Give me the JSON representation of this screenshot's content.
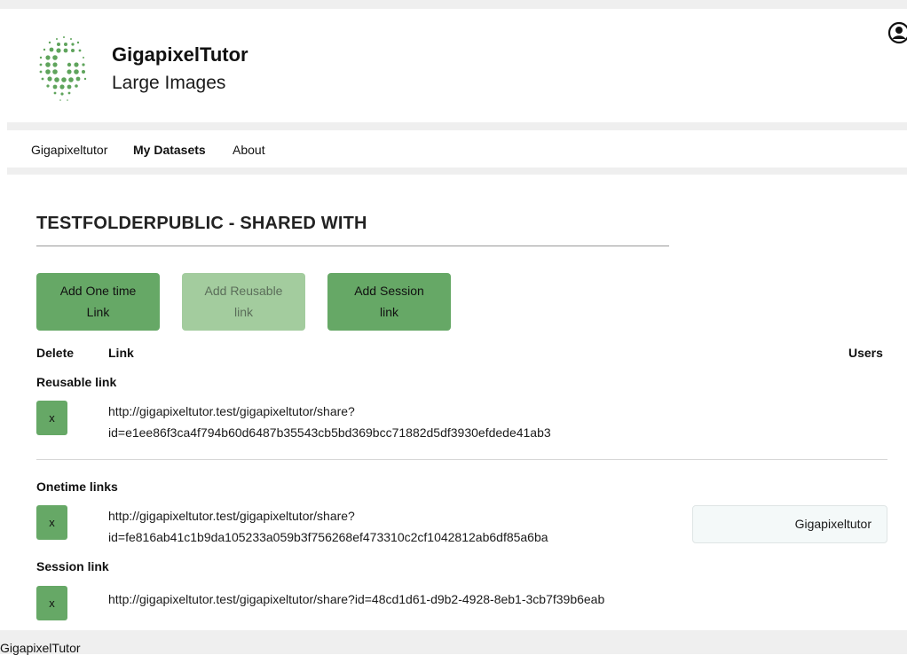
{
  "brand": {
    "title": "GigapixelTutor",
    "subtitle": "Large Images"
  },
  "nav": {
    "items": [
      "Gigapixeltutor",
      "My Datasets",
      "About"
    ],
    "active": "My Datasets"
  },
  "page": {
    "title": "TESTFOLDERPUBLIC - SHARED WITH"
  },
  "buttons": {
    "one_time": {
      "line1": "Add One time",
      "line2": "Link"
    },
    "reusable": {
      "line1": "Add Reusable",
      "line2": "link",
      "disabled": true
    },
    "session": {
      "line1": "Add Session",
      "line2": "link"
    }
  },
  "columns": {
    "delete": "Delete",
    "link": "Link",
    "users": "Users"
  },
  "sections": {
    "reusable": {
      "heading": "Reusable link",
      "delete_label": "x",
      "url_line1": "http://gigapixeltutor.test/gigapixeltutor/share?",
      "url_line2": "id=e1ee86f3ca4f794b60d6487b35543cb5bd369bcc71882d5df3930efdede41ab3"
    },
    "onetime": {
      "heading": "Onetime links",
      "delete_label": "x",
      "url_line1": "http://gigapixeltutor.test/gigapixeltutor/share?",
      "url_line2": "id=fe816ab41c1b9da105233a059b3f756268ef473310c2cf1042812ab6df85a6ba",
      "user": "Gigapixeltutor"
    },
    "session": {
      "heading": "Session link",
      "delete_label": "x",
      "url": "http://gigapixeltutor.test/gigapixeltutor/share?id=48cd1d61-d9b2-4928-8eb1-3cb7f39b6eab"
    }
  },
  "footer": {
    "text": "GigapixelTutor"
  },
  "colors": {
    "accent": "#66a866",
    "accent_disabled": "#a3cc9e",
    "separator": "#efefef"
  },
  "icons": {
    "account": "account-circle-icon",
    "logo": "gigapixeltutor-logo"
  }
}
